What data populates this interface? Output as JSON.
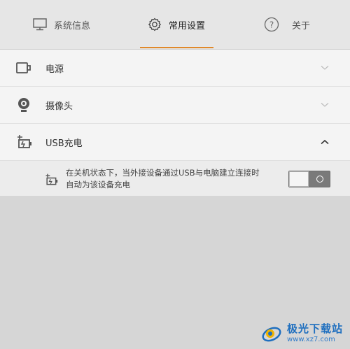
{
  "tabs": [
    {
      "label": "系统信息",
      "icon": "monitor-icon"
    },
    {
      "label": "常用设置",
      "icon": "gear-icon"
    },
    {
      "label": "关于",
      "icon": "help-circle-icon"
    }
  ],
  "active_tab": "常用设置",
  "accent_color": "#e0892b",
  "settings": {
    "power": {
      "label": "电源",
      "icon": "battery-icon"
    },
    "camera": {
      "label": "摄像头",
      "icon": "webcam-icon"
    },
    "usb": {
      "label": "USB充电",
      "icon": "usb-charge-icon",
      "expanded": true,
      "option": {
        "description_line1": "在关机状态下，当外接设备通过USB与电脑建立连接时",
        "description_line2": "自动为该设备充电",
        "enabled": false
      }
    }
  },
  "watermark": {
    "name": "极光下载站",
    "url": "www.xz7.com"
  }
}
